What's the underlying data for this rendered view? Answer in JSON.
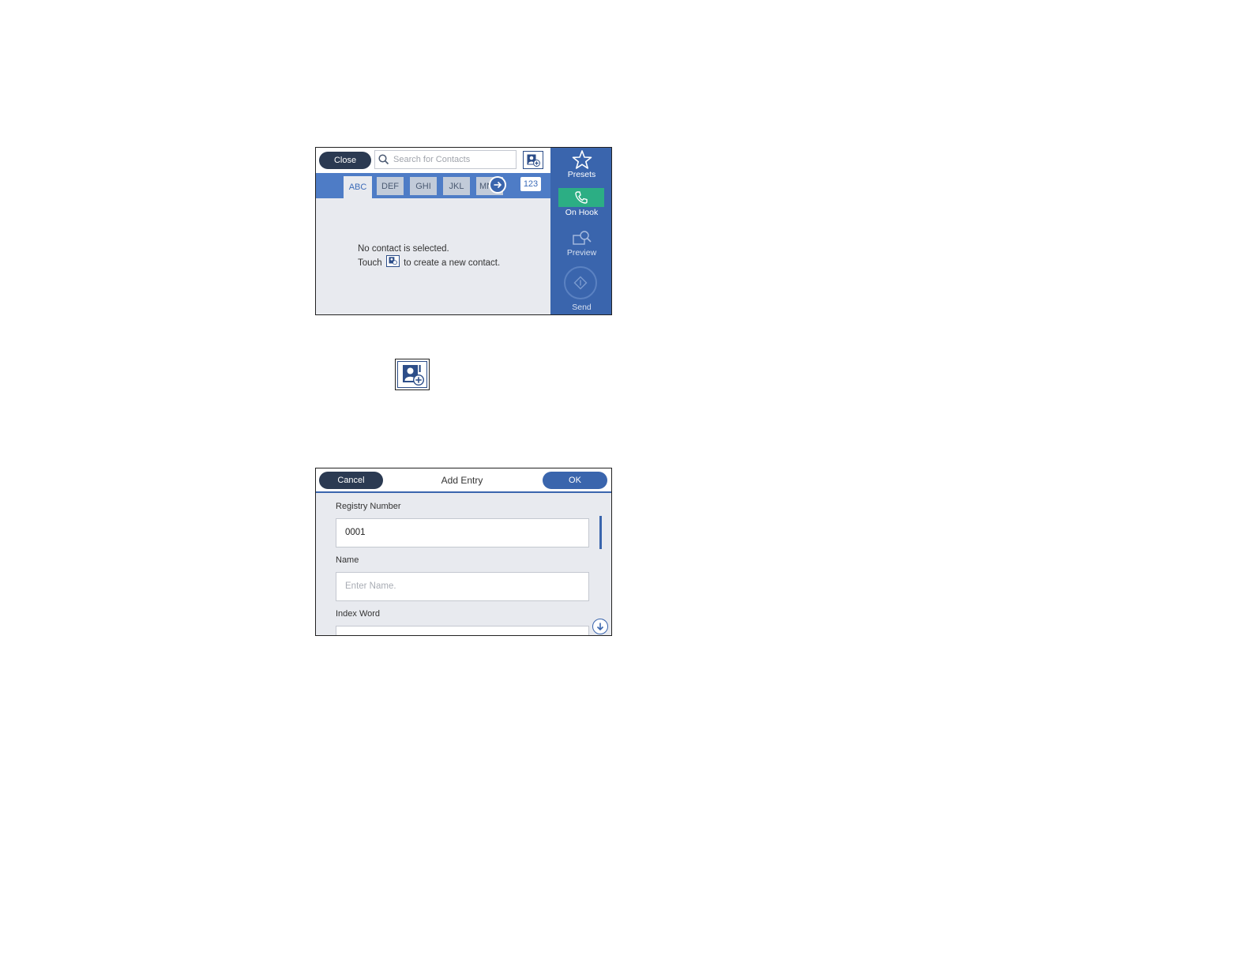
{
  "contacts_screen": {
    "close_label": "Close",
    "search_placeholder": "Search for Contacts",
    "tabs": [
      "ABC",
      "DEF",
      "GHI",
      "JKL",
      "MN"
    ],
    "tab_123": "123",
    "empty_line1": "No contact is selected.",
    "empty_line2_prefix": "Touch",
    "empty_line2_suffix": "to create a new contact.",
    "sidebar": {
      "presets": "Presets",
      "on_hook": "On Hook",
      "preview": "Preview",
      "send": "Send"
    }
  },
  "add_entry_screen": {
    "cancel_label": "Cancel",
    "title": "Add Entry",
    "ok_label": "OK",
    "registry_label": "Registry Number",
    "registry_value": "0001",
    "name_label": "Name",
    "name_placeholder": "Enter Name.",
    "index_label": "Index Word"
  },
  "colors": {
    "accent_blue": "#3a65ad",
    "dark_button": "#2b3a52",
    "on_hook_green": "#2cae84",
    "panel_bg": "#e8eaef"
  },
  "icons": {
    "search": "search-icon",
    "add_contact": "add-contact-icon",
    "presets": "star-icon",
    "on_hook": "phone-icon",
    "preview": "preview-icon",
    "send": "send-icon",
    "next": "arrow-right-icon",
    "scroll_down": "arrow-down-icon"
  }
}
